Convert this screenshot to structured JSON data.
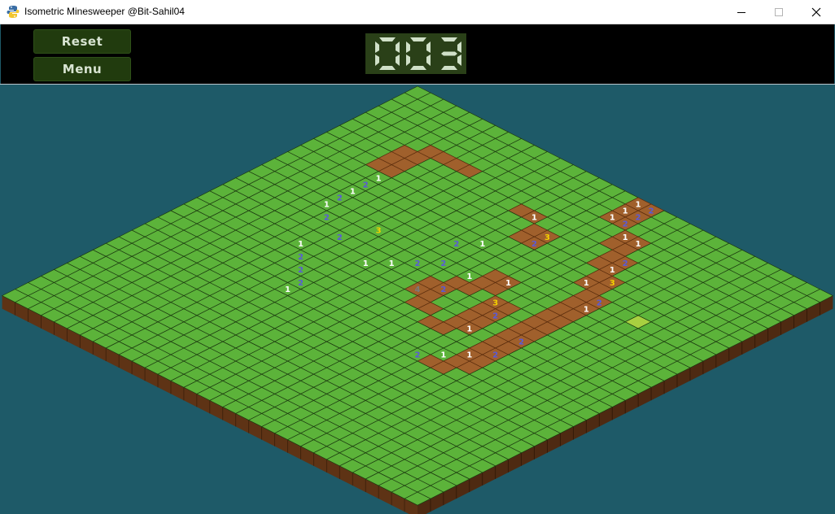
{
  "window": {
    "title": "Isometric Minesweeper @Bit-Sahil04",
    "icon": "snake-python-icon"
  },
  "toolbar": {
    "reset_label": "Reset",
    "menu_label": "Menu"
  },
  "mine_counter": {
    "value": "003",
    "digit_color": "#d0e0c8",
    "background": "#2a4018"
  },
  "board": {
    "grid_size": 32,
    "colors": {
      "background": "#1e5a68",
      "covered": "#5cb33a",
      "covered_hover": "#a8d040",
      "revealed": "#a0602c",
      "side": "#5e3315",
      "grid_line": "#1c3a10",
      "number_1": "#ffffff",
      "number_2": "#5a5ad8",
      "number_3": "#f4d000",
      "number_4": "#7a7a7a"
    },
    "highlighted_cell": [
      26,
      9
    ],
    "revealed_rows": [
      "0,3:17,18:31",
      "0,3:17,18:31",
      "0,3:17,18:31",
      "0,3:19,20:31",
      "0,3:5,6:7,8:19,20:31",
      "0,3:4,5:13,14:20,21:31",
      "0,3:4,5:15,16:20,21:31",
      "0,3:4,5:15,16:21,22:31",
      "0,5:21,22:31",
      "0,5:22,23:31",
      "0,5:22,23:31",
      "0,5:17,18:22,23:31",
      "0,5:17,18:22,23:31",
      "0,5:16,17:19,20:22,23:31",
      "0,5:15,16:19,20:22,23:31",
      "0,5:15,16:19,20:22,23:31",
      "0,5:16,17:19,20:22,23:31",
      "0,6:18,19:22,23:31",
      "0,8:22,23:31",
      "0,9:22,23:31",
      "0,9:21,22:31",
      "0,31",
      "0,31",
      "0,31",
      "0,31",
      "0,31",
      "0,31",
      "0,31",
      "0,31",
      "0,31",
      "0,31",
      "0,31"
    ],
    "numbers": [
      {
        "x": 17,
        "y": 0,
        "n": "1"
      },
      {
        "x": 18,
        "y": 0,
        "n": "2"
      },
      {
        "x": 17,
        "y": 1,
        "n": "1"
      },
      {
        "x": 18,
        "y": 1,
        "n": "2"
      },
      {
        "x": 17,
        "y": 2,
        "n": "1"
      },
      {
        "x": 18,
        "y": 2,
        "n": "2"
      },
      {
        "x": 19,
        "y": 3,
        "n": "1"
      },
      {
        "x": 20,
        "y": 3,
        "n": "1"
      },
      {
        "x": 14,
        "y": 5,
        "n": "1"
      },
      {
        "x": 21,
        "y": 5,
        "n": "2"
      },
      {
        "x": 16,
        "y": 6,
        "n": "3"
      },
      {
        "x": 21,
        "y": 6,
        "n": "1"
      },
      {
        "x": 16,
        "y": 7,
        "n": "2"
      },
      {
        "x": 22,
        "y": 7,
        "n": "3"
      },
      {
        "x": 5,
        "y": 8,
        "n": "1"
      },
      {
        "x": 21,
        "y": 8,
        "n": "1"
      },
      {
        "x": 5,
        "y": 9,
        "n": "2"
      },
      {
        "x": 23,
        "y": 9,
        "n": "2"
      },
      {
        "x": 5,
        "y": 10,
        "n": "1"
      },
      {
        "x": 23,
        "y": 10,
        "n": "1"
      },
      {
        "x": 5,
        "y": 11,
        "n": "2"
      },
      {
        "x": 18,
        "y": 11,
        "n": "1"
      },
      {
        "x": 5,
        "y": 12,
        "n": "1"
      },
      {
        "x": 16,
        "y": 12,
        "n": "1"
      },
      {
        "x": 6,
        "y": 13,
        "n": "2"
      },
      {
        "x": 19,
        "y": 13,
        "n": "3"
      },
      {
        "x": 16,
        "y": 14,
        "n": "2"
      },
      {
        "x": 20,
        "y": 14,
        "n": "2"
      },
      {
        "x": 15,
        "y": 15,
        "n": "4"
      },
      {
        "x": 23,
        "y": 15,
        "n": "2"
      },
      {
        "x": 7,
        "y": 16,
        "n": "1"
      },
      {
        "x": 20,
        "y": 16,
        "n": "1"
      },
      {
        "x": 8,
        "y": 17,
        "n": "2"
      },
      {
        "x": 23,
        "y": 17,
        "n": "2"
      },
      {
        "x": 9,
        "y": 18,
        "n": "2"
      },
      {
        "x": 22,
        "y": 18,
        "n": "1"
      },
      {
        "x": 10,
        "y": 19,
        "n": "2"
      },
      {
        "x": 21,
        "y": 19,
        "n": "1"
      },
      {
        "x": 10,
        "y": 20,
        "n": "1"
      },
      {
        "x": 20,
        "y": 20,
        "n": "2"
      },
      {
        "x": 12,
        "y": 14,
        "n": "1"
      },
      {
        "x": 11,
        "y": 15,
        "n": "1"
      },
      {
        "x": 13,
        "y": 13,
        "n": "2"
      },
      {
        "x": 14,
        "y": 12,
        "n": "2"
      },
      {
        "x": 9,
        "y": 12,
        "n": "3"
      },
      {
        "x": 8,
        "y": 14,
        "n": "2"
      },
      {
        "x": 14,
        "y": 9,
        "n": "1"
      },
      {
        "x": 13,
        "y": 10,
        "n": "2"
      }
    ]
  }
}
